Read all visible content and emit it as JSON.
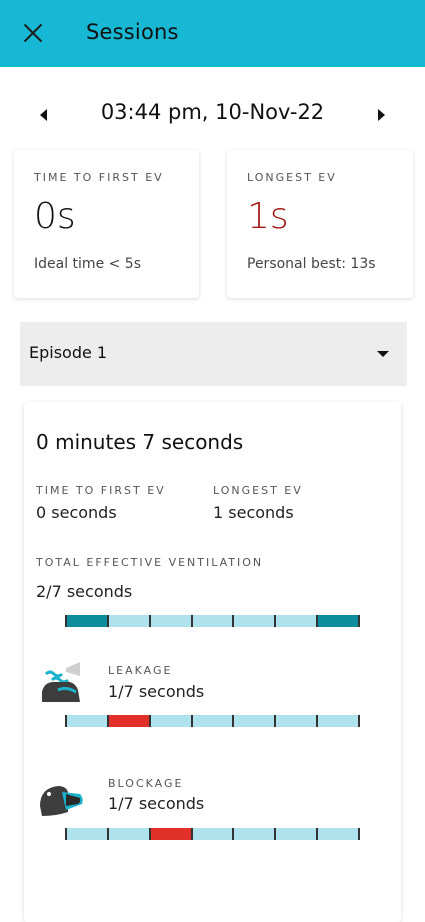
{
  "header": {
    "title": "Sessions"
  },
  "date_nav": {
    "datetime": "03:44 pm, 10-Nov-22"
  },
  "summary": {
    "first_ev": {
      "caption": "TIME TO FIRST EV",
      "value": "0s",
      "note": "Ideal time < 5s"
    },
    "longest_ev": {
      "caption": "LONGEST EV",
      "value": "1s",
      "note": "Personal best: 13s",
      "value_color": "#a41a1a"
    }
  },
  "episode_select": {
    "selected": "Episode 1"
  },
  "episode": {
    "duration": "0 minutes 7 seconds",
    "first_ev_caption": "TIME TO FIRST EV",
    "first_ev_value": "0 seconds",
    "longest_ev_caption": "LONGEST EV",
    "longest_ev_value": "1 seconds",
    "total_caption": "TOTAL EFFECTIVE VENTILATION",
    "total_value": "2/7 seconds",
    "total_timeline": [
      "active",
      "off",
      "off",
      "off",
      "off",
      "off",
      "active"
    ],
    "leakage_caption": "LEAKAGE",
    "leakage_value": "1/7 seconds",
    "leakage_timeline": [
      "off",
      "alert",
      "off",
      "off",
      "off",
      "off",
      "off"
    ],
    "blockage_caption": "BLOCKAGE",
    "blockage_value": "1/7 seconds",
    "blockage_timeline": [
      "off",
      "off",
      "alert",
      "off",
      "off",
      "off",
      "off"
    ]
  },
  "colors": {
    "app_bar": "#16b8d4",
    "timeline_off": "#aee3ee",
    "timeline_active": "#0d8c9c",
    "timeline_alert": "#e12f2a"
  },
  "icons": [
    "close-icon",
    "chevron-left-icon",
    "chevron-right-icon",
    "dropdown-arrow-icon",
    "mask-leakage-icon",
    "mask-blockage-icon"
  ]
}
